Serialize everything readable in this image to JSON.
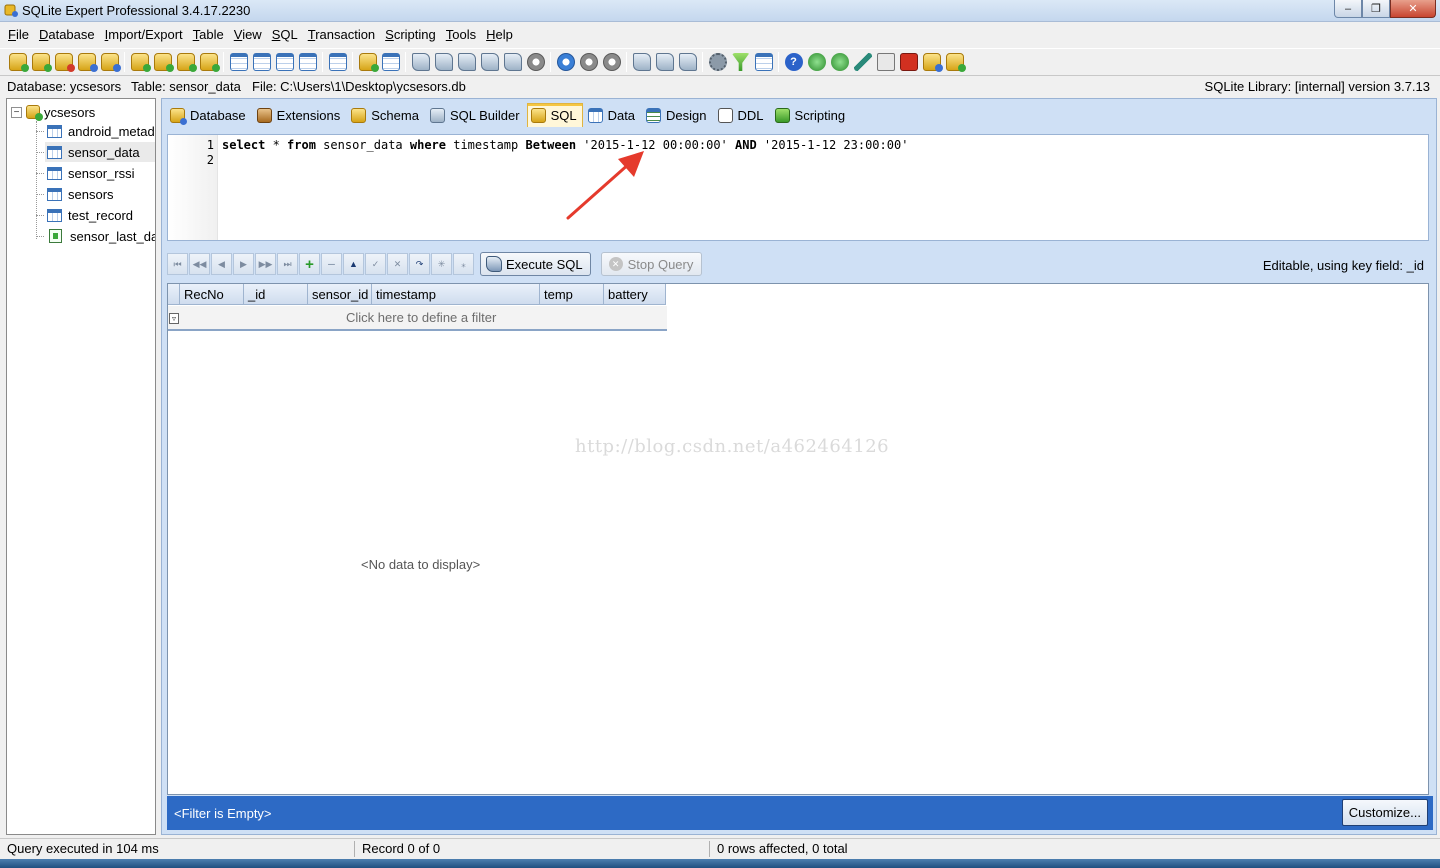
{
  "window": {
    "title": "SQLite Expert Professional 3.4.17.2230",
    "controls": [
      "‒",
      "❐",
      "✕"
    ]
  },
  "menu": [
    {
      "label": "File",
      "ul": "F",
      "rest": "ile"
    },
    {
      "label": "Database",
      "ul": "D",
      "rest": "atabase"
    },
    {
      "label": "Import/Export",
      "ul": "I",
      "rest": "mport/Export"
    },
    {
      "label": "Table",
      "ul": "T",
      "rest": "able"
    },
    {
      "label": "View",
      "ul": "V",
      "rest": "iew"
    },
    {
      "label": "SQL",
      "ul": "S",
      "rest": "QL"
    },
    {
      "label": "Transaction",
      "ul": "T",
      "rest": "ransaction"
    },
    {
      "label": "Scripting",
      "ul": "S",
      "rest": "cripting"
    },
    {
      "label": "Tools",
      "ul": "T",
      "rest": "ools"
    },
    {
      "label": "Help",
      "ul": "H",
      "rest": "elp"
    }
  ],
  "infobar": {
    "database": "Database: ycsesors",
    "table": "Table: sensor_data",
    "file": "File: C:\\Users\\1\\Desktop\\ycsesors.db",
    "library": "SQLite Library: [internal] version 3.7.13"
  },
  "tree": {
    "root": "ycsesors",
    "items": [
      {
        "label": "android_metadata",
        "kind": "table"
      },
      {
        "label": "sensor_data",
        "kind": "table",
        "selected": true
      },
      {
        "label": "sensor_rssi",
        "kind": "table"
      },
      {
        "label": "sensors",
        "kind": "table"
      },
      {
        "label": "test_record",
        "kind": "table"
      },
      {
        "label": "sensor_last_data",
        "kind": "view"
      }
    ]
  },
  "tabs": [
    {
      "label": "Database",
      "icon": "database-icon"
    },
    {
      "label": "Extensions",
      "icon": "extensions-icon"
    },
    {
      "label": "Schema",
      "icon": "schema-icon"
    },
    {
      "label": "SQL Builder",
      "icon": "sql-builder-icon"
    },
    {
      "label": "SQL",
      "icon": "sql-icon",
      "active": true
    },
    {
      "label": "Data",
      "icon": "data-icon"
    },
    {
      "label": "Design",
      "icon": "design-icon"
    },
    {
      "label": "DDL",
      "icon": "ddl-icon"
    },
    {
      "label": "Scripting",
      "icon": "scripting-icon"
    }
  ],
  "editor": {
    "line_numbers": [
      "1",
      "2"
    ],
    "tokens": [
      {
        "t": "select",
        "kw": true
      },
      {
        "t": " * "
      },
      {
        "t": "from",
        "kw": true
      },
      {
        "t": " sensor_data "
      },
      {
        "t": "where",
        "kw": true
      },
      {
        "t": " timestamp "
      },
      {
        "t": "Between",
        "kw": true
      },
      {
        "t": " '2015-1-12 00:00:00' "
      },
      {
        "t": "AND",
        "kw": true
      },
      {
        "t": " '2015-1-12 23:00:00'"
      }
    ]
  },
  "data_toolbar": {
    "nav": [
      "⏮",
      "◀◀",
      "◀",
      "▶",
      "▶▶",
      "⏭",
      "+",
      "−",
      "▲",
      "✓",
      "✕",
      "↷",
      "✳",
      "⁎"
    ],
    "execute_label": "Execute SQL",
    "stop_label": "Stop Query",
    "editable_info": "Editable, using key field: _id"
  },
  "grid": {
    "columns": [
      "RecNo",
      "_id",
      "sensor_id",
      "timestamp",
      "temp",
      "battery"
    ],
    "filter_placeholder": "Click here to define a filter",
    "filter_icon_glyph": "▿",
    "empty_text": "<No data to display>",
    "watermark": "http://blog.csdn.net/a462464126"
  },
  "filterbar": {
    "status": "<Filter is Empty>",
    "customize_label": "Customize..."
  },
  "statusbar": {
    "query_time": "Query executed in 104 ms",
    "record": "Record 0 of 0",
    "rows": "0 rows affected, 0 total"
  },
  "colors": {
    "accent": "#2d6ac5",
    "panel": "#cfe0f5",
    "active_tab": "#fff7d9",
    "annotation_arrow": "#e53a2c"
  }
}
